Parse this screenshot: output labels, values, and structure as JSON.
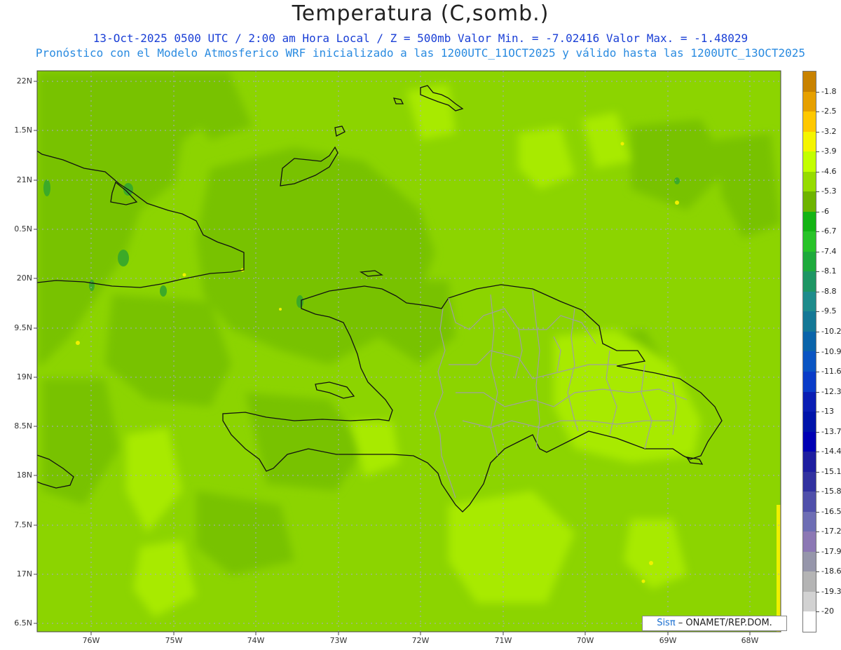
{
  "title": "Temperatura (C,somb.)",
  "subtitle_line1": "13-Oct-2025  0500 UTC / 2:00 am Hora Local / Z = 500mb  Valor Min. = -7.02416  Valor Max. = -1.48029",
  "subtitle_line2": "Pronóstico con el Modelo Atmosferico WRF inicializado a las 1200UTC_11OCT2025 y válido hasta las  1200UTC_13OCT2025",
  "lat_labels": [
    "22N",
    "1.5N",
    "21N",
    "0.5N",
    "20N",
    "9.5N",
    "19N",
    "8.5N",
    "18N",
    "7.5N",
    "17N",
    "6.5N"
  ],
  "lon_labels": [
    "76W",
    "75W",
    "74W",
    "73W",
    "72W",
    "71W",
    "70W",
    "69W",
    "68W"
  ],
  "colorbar": {
    "labels": [
      "-1.8",
      "-2.5",
      "-3.2",
      "-3.9",
      "-4.6",
      "-5.3",
      "-6",
      "-6.7",
      "-7.4",
      "-8.1",
      "-8.8",
      "-9.5",
      "-10.2",
      "-10.9",
      "-11.6",
      "-12.3",
      "-13",
      "-13.7",
      "-14.4",
      "-15.1",
      "-15.8",
      "-16.5",
      "-17.2",
      "-17.9",
      "-18.6",
      "-19.3",
      "-20"
    ],
    "colors": [
      "#c88200",
      "#e6a000",
      "#ffc800",
      "#f5f500",
      "#c3ff00",
      "#96dc00",
      "#6eb400",
      "#14b414",
      "#28c328",
      "#1eaa3c",
      "#1e9664",
      "#1e8c8c",
      "#147896",
      "#0a64aa",
      "#0a55c3",
      "#0a3cc8",
      "#0a1eb4",
      "#0014aa",
      "#0000b4",
      "#1e1ea0",
      "#3232a0",
      "#5050aa",
      "#6e6eb4",
      "#8c78b4",
      "#9696aa",
      "#b4b4b4",
      "#d2d2d2",
      "#ffffff"
    ]
  },
  "map_colors": {
    "base": "#8cd400",
    "dark": "#78c200",
    "darkest": "#3caa28",
    "light": "#a8ea00",
    "yellow": "#f0f000",
    "coast": "#111111",
    "border": "#a0a0a0"
  },
  "credit": {
    "sis": "Sisπ",
    "org": " – ONAMET/REP.DOM."
  }
}
